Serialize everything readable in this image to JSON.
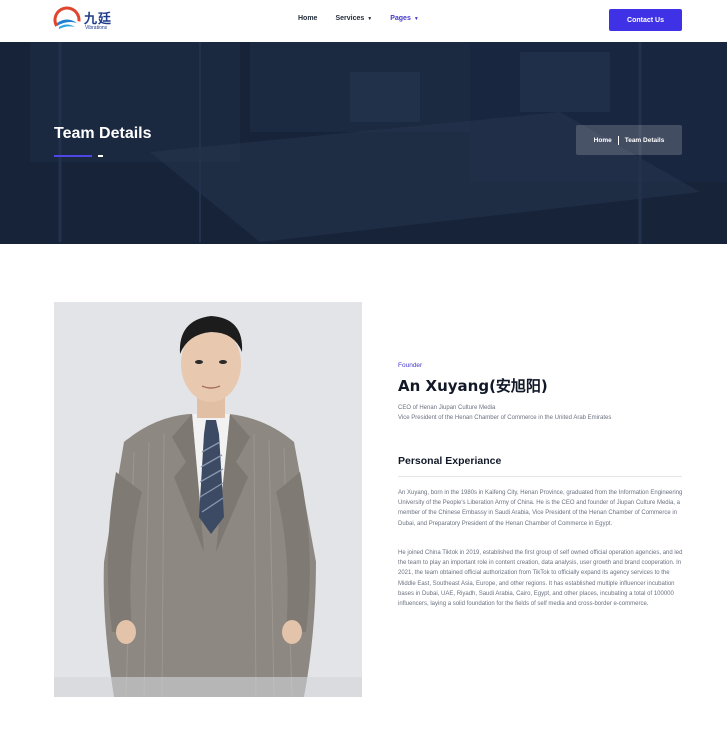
{
  "header": {
    "logo_cn": "九廷",
    "logo_en": "Vibrations",
    "nav": [
      {
        "label": "Home",
        "caret": false,
        "active": false
      },
      {
        "label": "Services",
        "caret": true,
        "active": false
      },
      {
        "label": "Pages",
        "caret": true,
        "active": true
      }
    ],
    "contact_label": "Contact Us"
  },
  "banner": {
    "title": "Team Details",
    "breadcrumb": [
      "Home",
      "Team Details"
    ]
  },
  "profile": {
    "role": "Founder",
    "name": "An Xuyang(安旭阳)",
    "subtitle_1": "CEO of Henan Jiupan Culture Media",
    "subtitle_2": "Vice President of the Henan Chamber of Commerce in the United Arab Emirates",
    "section_title": "Personal Experiance",
    "paragraph_1": "An Xuyang, born in the 1980s in Kaifeng City, Henan Province, graduated from the Information Engineering University of the People's Liberation Army of China. He is the CEO and founder of Jiupan Culture Media, a member of the Chinese Embassy in Saudi Arabia, Vice President of the Henan Chamber of Commerce in Dubai, and Preparatory President of the Henan Chamber of Commerce in Egypt.",
    "paragraph_2": "He joined China Tiktok in 2019, established the first group of self owned official operation agencies, and led the team to play an important role in content creation, data analysis, user growth and brand cooperation. In 2021, the team obtained official authorization from TikTok to officially expand its agency services to the Middle East, Southeast Asia, Europe, and other regions. It has established multiple influencer incubation bases in Dubai, UAE, Riyadh, Saudi Arabia, Cairo, Egypt, and other places, incubating a total of 100000 influencers, laying a solid foundation for the fields of self media and cross-border e-commerce."
  },
  "colors": {
    "accent": "#3f32e6",
    "banner_bg": "#1b263b",
    "suit": "#8d8881"
  }
}
